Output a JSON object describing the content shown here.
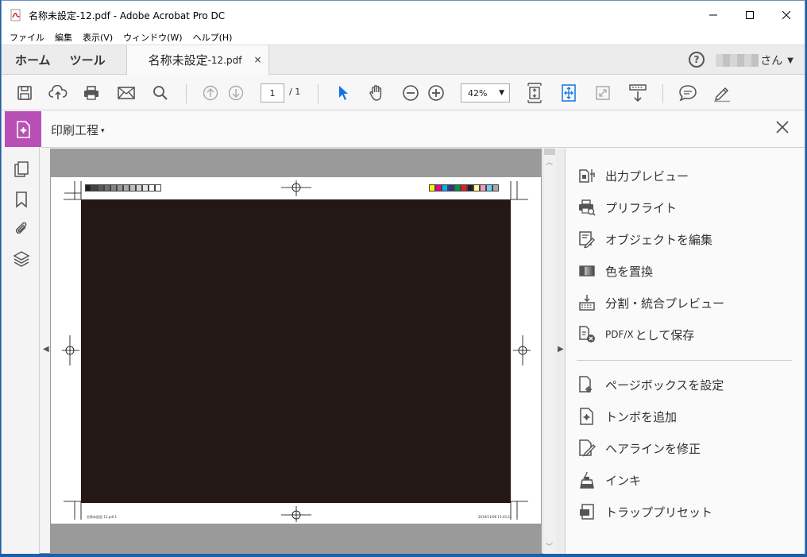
{
  "window": {
    "title": "名称未設定-12.pdf - Adobe Acrobat Pro DC"
  },
  "menu": [
    "ファイル",
    "編集",
    "表示(V)",
    "ウィンドウ(W)",
    "ヘルプ(H)"
  ],
  "tabs": {
    "home": "ホーム",
    "tools": "ツール",
    "document_name": "名称未設定",
    "document_suffix": "-12.pdf",
    "close": "×"
  },
  "user": {
    "help": "?",
    "suffix": "さん"
  },
  "toolbar": {
    "page_current": "1",
    "page_total": "/ 1",
    "zoom": "42%"
  },
  "tool_header": {
    "name": "印刷工程",
    "caret": "▾"
  },
  "page_footer": {
    "left": "名称未設定-12.pdf  1",
    "right": "2019/11/08  11:43:21"
  },
  "right_panel": {
    "items": [
      {
        "label": "出力プレビュー",
        "icon": "output-preview-icon"
      },
      {
        "label": "プリフライト",
        "icon": "preflight-icon"
      },
      {
        "label": "オブジェクトを編集",
        "icon": "edit-object-icon"
      },
      {
        "label": "色を置換",
        "icon": "replace-color-icon"
      },
      {
        "label": "分割・統合プレビュー",
        "icon": "flattener-preview-icon"
      },
      {
        "prefix": "PDF/X",
        "label": "として保存",
        "icon": "save-pdfx-icon"
      },
      {
        "label": "ページボックスを設定",
        "icon": "page-box-icon"
      },
      {
        "label": "トンボを追加",
        "icon": "add-marks-icon"
      },
      {
        "label": "ヘアラインを修正",
        "icon": "fix-hairline-icon"
      },
      {
        "label": "インキ",
        "icon": "ink-icon"
      },
      {
        "label": "トラッププリセット",
        "icon": "trap-preset-icon"
      }
    ]
  },
  "colors": {
    "accent": "#b84fb5",
    "artwork": "#231815",
    "select_tool": "#1473e6",
    "color_bar": [
      "#fff200",
      "#ec008c",
      "#00aeef",
      "#2e3192",
      "#009444",
      "#ed1c24",
      "#231f20",
      "#fff799",
      "#f49ac1",
      "#6dcff6",
      "#a7a9ac"
    ],
    "gray_bar": [
      "#231f20",
      "#414042",
      "#58595b",
      "#6d6e71",
      "#808285",
      "#939598",
      "#a7a9ac",
      "#bcbec0",
      "#d1d3d4",
      "#e6e7e8",
      "#ffffff"
    ]
  }
}
